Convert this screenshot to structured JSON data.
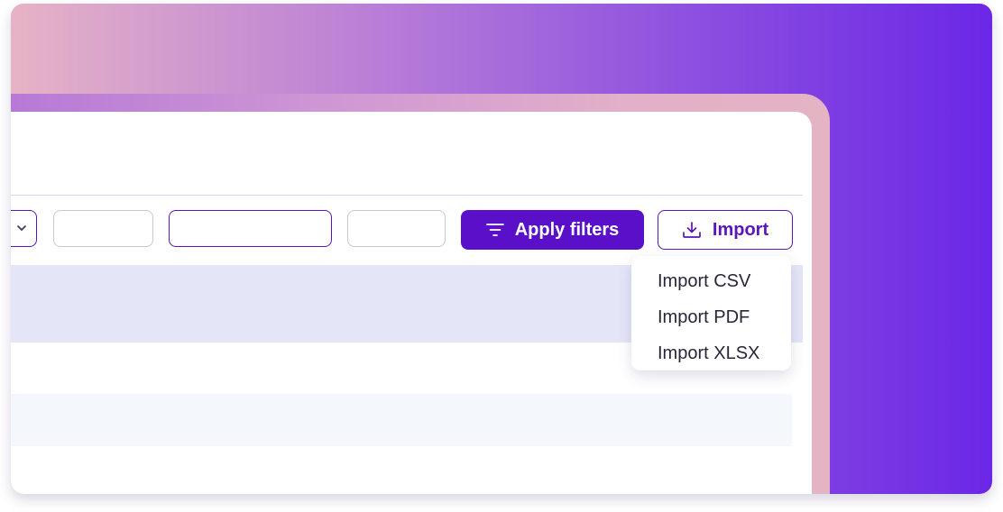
{
  "toolbar": {
    "apply_filters_label": "Apply filters",
    "import_label": "Import",
    "filter_icon": "filter-icon",
    "import_icon": "download-icon",
    "dropdown_icon": "chevron-down-icon"
  },
  "import_menu": {
    "items": [
      {
        "label": "Import CSV"
      },
      {
        "label": "Import PDF"
      },
      {
        "label": "Import XLSX"
      }
    ]
  },
  "colors": {
    "accent": "#5a0fc8",
    "accent_border": "#5a16b8",
    "selected_row": "#e4e6f8"
  }
}
